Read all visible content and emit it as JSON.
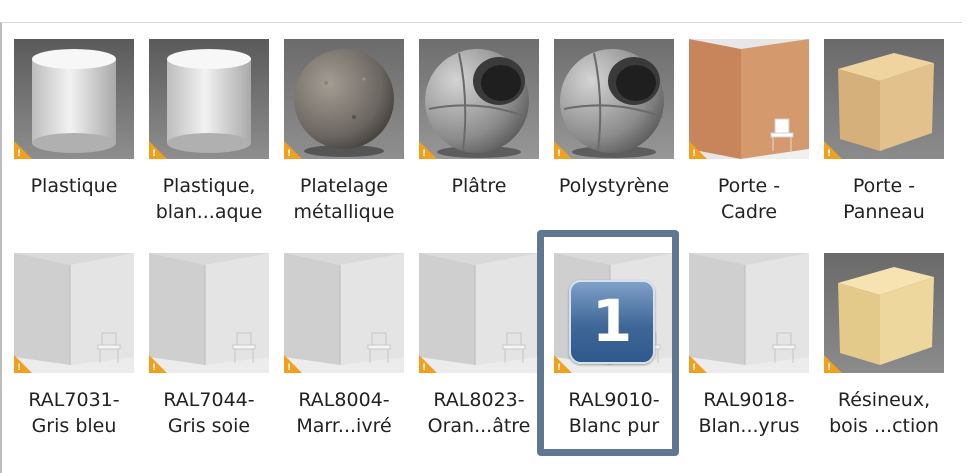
{
  "materials": [
    {
      "label": "Plastique",
      "thumb": "cylinder",
      "icon": "warning-icon"
    },
    {
      "label": "Plastique,\nblan...aque",
      "thumb": "cylinder",
      "icon": "warning-icon"
    },
    {
      "label": "Platelage\nmétallique",
      "thumb": "sphere-stone",
      "icon": "warning-icon"
    },
    {
      "label": "Plâtre",
      "thumb": "sphere-hollow",
      "icon": "warning-icon"
    },
    {
      "label": "Polystyrène",
      "thumb": "sphere-hollow",
      "icon": "warning-icon"
    },
    {
      "label": "Porte -\nCadre",
      "thumb": "corner-wood",
      "icon": "warning-icon"
    },
    {
      "label": "Porte -\nPanneau",
      "thumb": "cube-wood",
      "icon": "warning-icon"
    },
    {
      "label": "RAL7031-\nGris bleu",
      "thumb": "corner-room",
      "icon": "warning-icon"
    },
    {
      "label": "RAL7044-\nGris soie",
      "thumb": "corner-room",
      "icon": "warning-icon"
    },
    {
      "label": "RAL8004-\nMarr...ivré",
      "thumb": "corner-room",
      "icon": "warning-icon"
    },
    {
      "label": "RAL8023-\nOran...âtre",
      "thumb": "corner-room",
      "icon": "warning-icon"
    },
    {
      "label": "RAL9010-\nBlanc pur",
      "thumb": "corner-room",
      "icon": "warning-icon"
    },
    {
      "label": "RAL9018-\nBlan...yrus",
      "thumb": "corner-room",
      "icon": "warning-icon"
    },
    {
      "label": "Résineux,\nbois ...ction",
      "thumb": "cube-light",
      "icon": "warning-icon"
    }
  ],
  "annotation": {
    "badge_number": "1"
  },
  "colors": {
    "highlight_border": "#5f7791",
    "badge": "#3f6797",
    "warning": "#f1a01e"
  }
}
